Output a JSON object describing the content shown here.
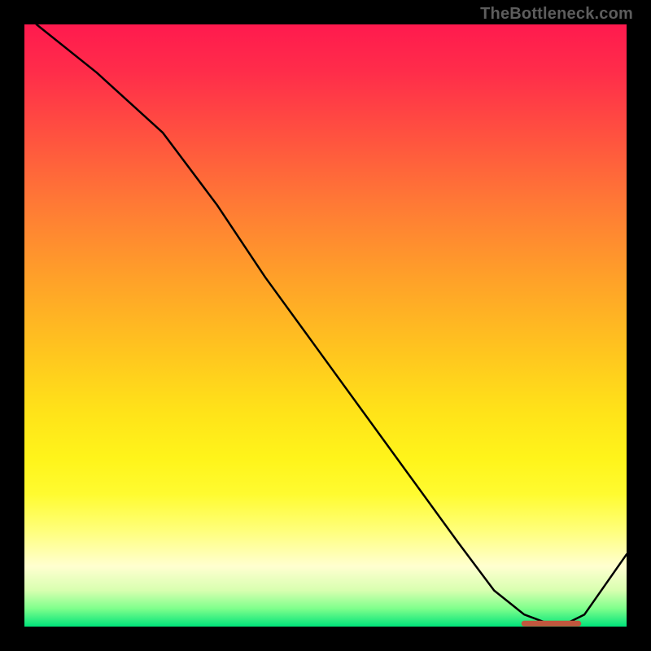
{
  "attribution": "TheBottleneck.com",
  "chart_data": {
    "type": "line",
    "title": "",
    "xlabel": "",
    "ylabel": "",
    "xlim": [
      0,
      100
    ],
    "ylim": [
      0,
      100
    ],
    "x": [
      2,
      12,
      23,
      32,
      40,
      48,
      56,
      64,
      72,
      78,
      83,
      87,
      90,
      93,
      100
    ],
    "values": [
      100,
      92,
      82,
      70,
      58,
      47,
      36,
      25,
      14,
      6,
      2,
      0.5,
      0.5,
      2,
      12
    ],
    "highlight_segment": {
      "x_start": 83,
      "x_end": 92,
      "y": 0.5
    }
  },
  "colors": {
    "curve": "#000000",
    "highlight": "#c1573e",
    "background_border": "#000000"
  }
}
